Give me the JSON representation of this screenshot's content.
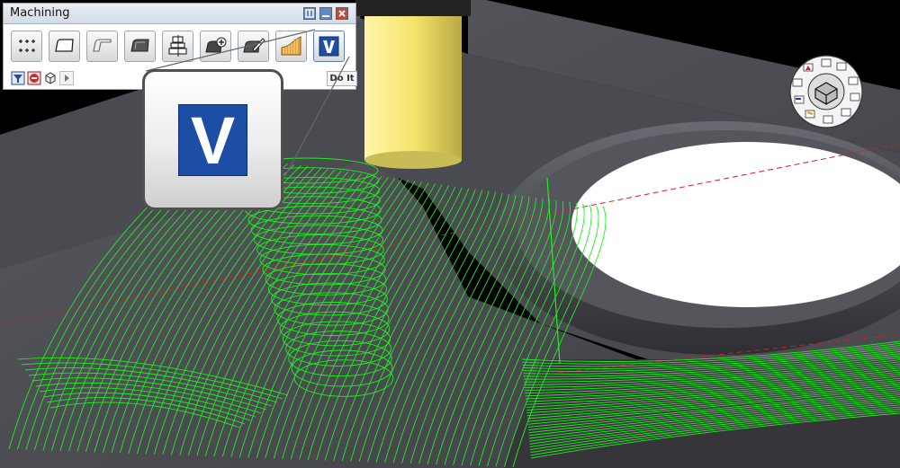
{
  "window": {
    "title": "Machining",
    "buttons": {
      "pin": "pin-icon",
      "minimize": "minimize-icon",
      "close": "close-icon"
    }
  },
  "toolbar": {
    "tools": [
      {
        "name": "drill-holes-tool",
        "icon": "drill-pattern-icon"
      },
      {
        "name": "profile-tool",
        "icon": "profile-icon"
      },
      {
        "name": "pocket-tool",
        "icon": "pocket-icon"
      },
      {
        "name": "surface-tool",
        "icon": "surface-icon"
      },
      {
        "name": "slice-tool",
        "icon": "slice-icon"
      },
      {
        "name": "add-tool",
        "icon": "add-icon"
      },
      {
        "name": "edit-tool",
        "icon": "edit-icon"
      },
      {
        "name": "roughing-tool",
        "icon": "roughing-icon"
      },
      {
        "name": "v-tool",
        "icon": "v-icon"
      }
    ],
    "bottom": {
      "icons": [
        "filter-icon",
        "stop-icon",
        "cube-icon",
        "play-icon"
      ],
      "do_it_label": "Do It"
    }
  },
  "callout": {
    "icon": "v-icon",
    "letter": "V"
  },
  "colors": {
    "toolpath": "#1ef01e",
    "model_surface": "#4f4f56",
    "background": "#000000",
    "spindle": "#f0e36a",
    "v_blue": "#1c4ea6"
  }
}
